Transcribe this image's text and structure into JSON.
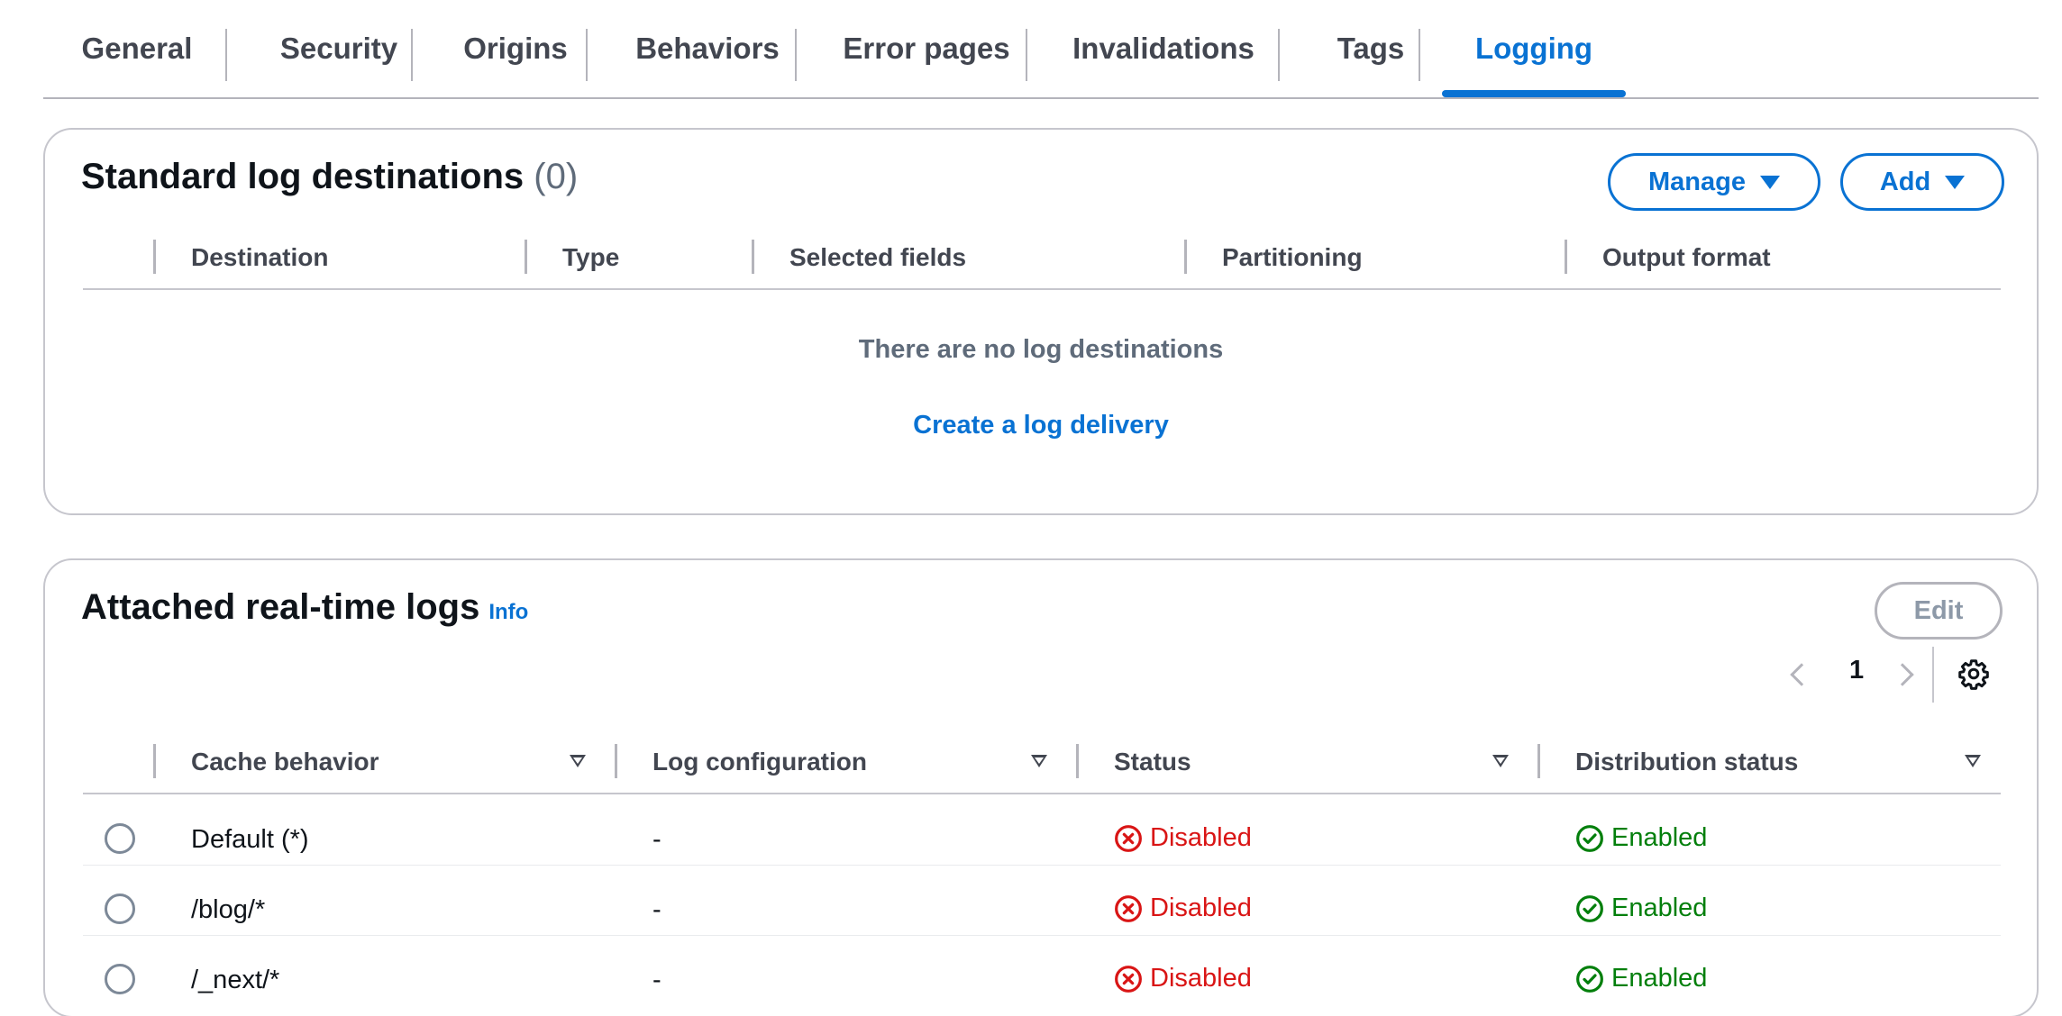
{
  "tabs": [
    {
      "label": "General"
    },
    {
      "label": "Security"
    },
    {
      "label": "Origins"
    },
    {
      "label": "Behaviors"
    },
    {
      "label": "Error pages"
    },
    {
      "label": "Invalidations"
    },
    {
      "label": "Tags"
    },
    {
      "label": "Logging"
    }
  ],
  "active_tab": "Logging",
  "standard_logs": {
    "title": "Standard log destinations",
    "count": "(0)",
    "manage_label": "Manage",
    "add_label": "Add",
    "columns": [
      "Destination",
      "Type",
      "Selected fields",
      "Partitioning",
      "Output format"
    ],
    "empty_message": "There are no log destinations",
    "create_link": "Create a log delivery"
  },
  "realtime_logs": {
    "title": "Attached real-time logs",
    "info_label": "Info",
    "edit_label": "Edit",
    "page_number": "1",
    "columns": [
      "Cache behavior",
      "Log configuration",
      "Status",
      "Distribution status"
    ],
    "rows": [
      {
        "cache_behavior": "Default (*)",
        "log_configuration": "-",
        "status": "Disabled",
        "distribution_status": "Enabled"
      },
      {
        "cache_behavior": "/blog/*",
        "log_configuration": "-",
        "status": "Disabled",
        "distribution_status": "Enabled"
      },
      {
        "cache_behavior": "/_next/*",
        "log_configuration": "-",
        "status": "Disabled",
        "distribution_status": "Enabled"
      }
    ]
  },
  "colors": {
    "accent": "#0972d3",
    "error": "#d91515",
    "success": "#037f0c",
    "text": "#0f141a",
    "muted": "#5f6b7a"
  }
}
